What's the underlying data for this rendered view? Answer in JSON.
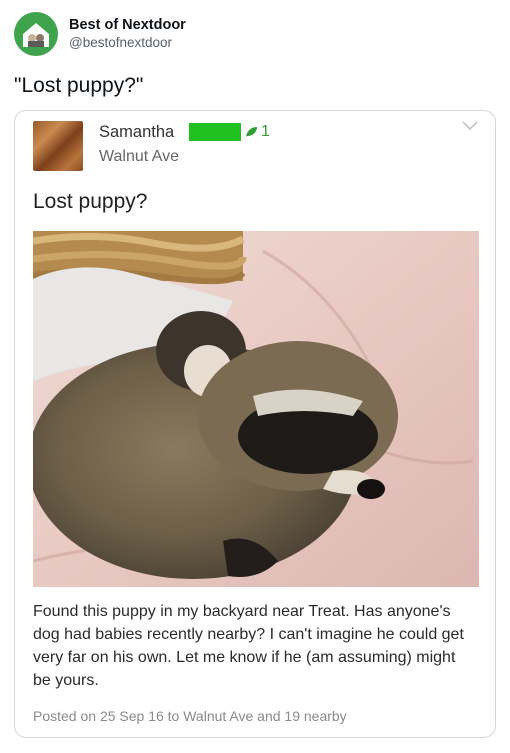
{
  "tweet": {
    "author_name": "Best of Nextdoor",
    "author_handle": "@bestofnextdoor",
    "text": "\"Lost puppy?\""
  },
  "post": {
    "poster_name": "Samantha",
    "badge_count": "1",
    "poster_street": "Walnut Ave",
    "title": "Lost puppy?",
    "body": "Found this puppy in my backyard near Treat.  Has anyone's dog had babies recently nearby?  I can't imagine he could get very far on his own.  Let me know if he (am assuming) might be yours.",
    "meta": "Posted on 25 Sep 16 to Walnut Ave and 19 nearby"
  },
  "colors": {
    "nextdoor_green": "#3fa34d",
    "badge_green": "#20c020"
  },
  "icons": [
    "nextdoor-house-icon",
    "leaf-icon",
    "chevron-down-icon"
  ]
}
